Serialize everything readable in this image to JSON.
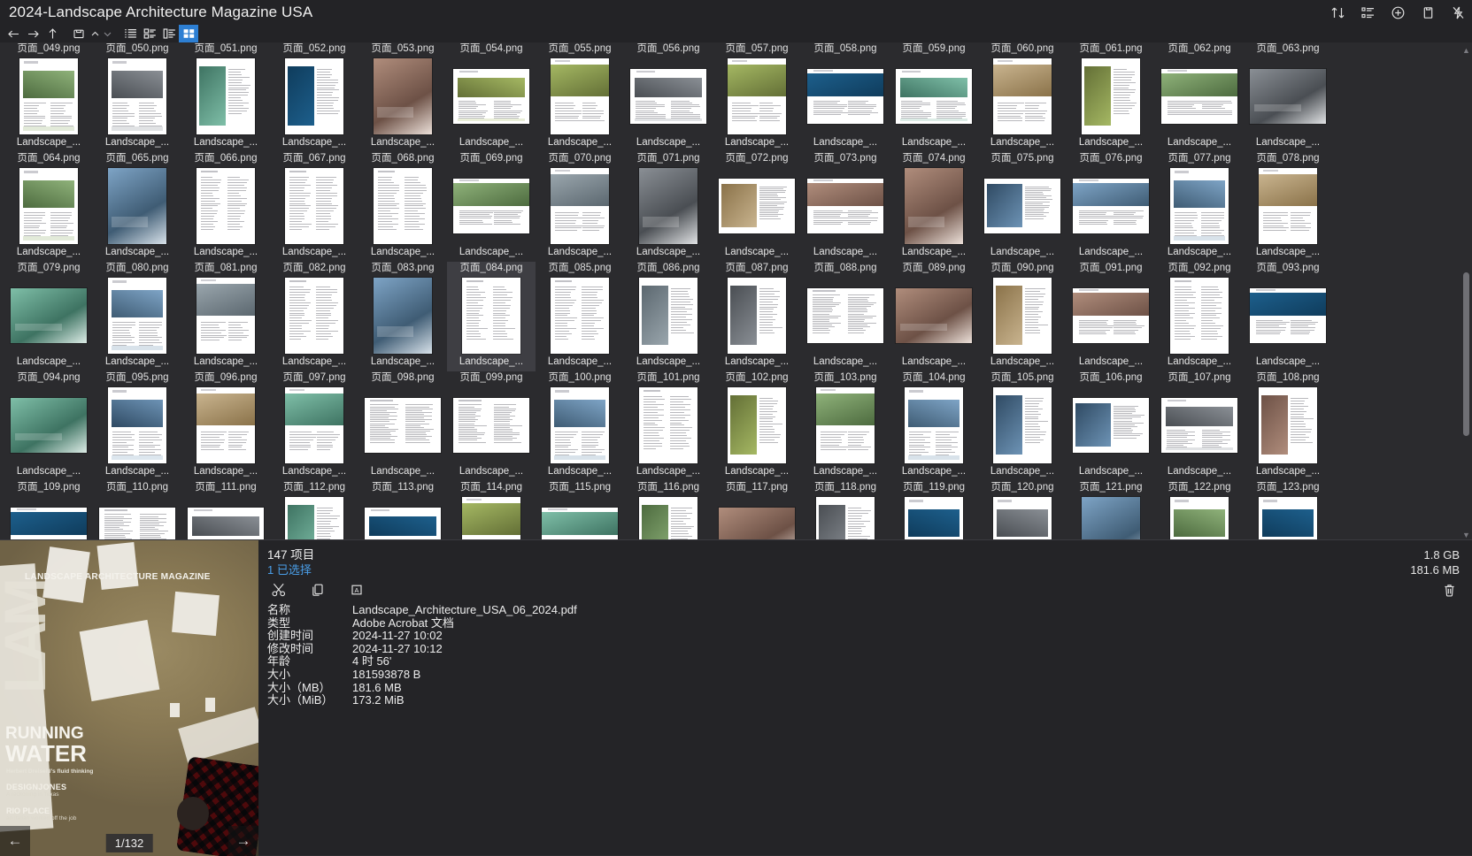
{
  "window": {
    "title": "2024-Landscape Architecture Magazine USA"
  },
  "titlebar_icons": [
    {
      "name": "sort-icon",
      "glyph": "sort"
    },
    {
      "name": "list-details-icon",
      "glyph": "details"
    },
    {
      "name": "add-circle-icon",
      "glyph": "plus-circle"
    },
    {
      "name": "clipboard-icon",
      "glyph": "clipboard"
    },
    {
      "name": "lightning-icon",
      "glyph": "bolt"
    }
  ],
  "toolbar": {
    "back": "←",
    "forward": "→",
    "up": "↑",
    "new_folder": "new-folder",
    "caret_up": "⌃",
    "caret_down": "⌄",
    "view_list": "list-view",
    "view_tiles": "tiles-view",
    "view_details": "details-view",
    "view_grid": "grid-view",
    "active_view": "grid-view"
  },
  "grid": {
    "columns": 15,
    "item_label": "Landscape_...",
    "selected_index": 35,
    "rows": [
      {
        "names": [
          "页面_049.png",
          "页面_050.png",
          "页面_051.png",
          "页面_052.png",
          "页面_053.png",
          "页面_054.png",
          "页面_055.png",
          "页面_056.png",
          "页面_057.png",
          "页面_058.png",
          "页面_059.png",
          "页面_060.png",
          "页面_061.png",
          "页面_062.png",
          "页面_063.png"
        ]
      },
      {
        "names": [
          "页面_064.png",
          "页面_065.png",
          "页面_066.png",
          "页面_067.png",
          "页面_068.png",
          "页面_069.png",
          "页面_070.png",
          "页面_071.png",
          "页面_072.png",
          "页面_073.png",
          "页面_074.png",
          "页面_075.png",
          "页面_076.png",
          "页面_077.png",
          "页面_078.png"
        ]
      },
      {
        "names": [
          "页面_079.png",
          "页面_080.png",
          "页面_081.png",
          "页面_082.png",
          "页面_083.png",
          "页面_084.png",
          "页面_085.png",
          "页面_086.png",
          "页面_087.png",
          "页面_088.png",
          "页面_089.png",
          "页面_090.png",
          "页面_091.png",
          "页面_092.png",
          "页面_093.png"
        ]
      },
      {
        "names": [
          "页面_094.png",
          "页面_095.png",
          "页面_096.png",
          "页面_097.png",
          "页面_098.png",
          "页面_099.png",
          "页面_100.png",
          "页面_101.png",
          "页面_102.png",
          "页面_103.png",
          "页面_104.png",
          "页面_105.png",
          "页面_106.png",
          "页面_107.png",
          "页面_108.png"
        ]
      },
      {
        "names": [
          "页面_109.png",
          "页面_110.png",
          "页面_111.png",
          "页面_112.png",
          "页面_113.png",
          "页面_114.png",
          "页面_115.png",
          "页面_116.png",
          "页面_117.png",
          "页面_118.png",
          "页面_119.png",
          "页面_120.png",
          "页面_121.png",
          "页面_122.png",
          "页面_123.png"
        ]
      },
      {
        "names": [
          "",
          "",
          "",
          "",
          "",
          "",
          "",
          "",
          "",
          "",
          "",
          "",
          "",
          "",
          ""
        ]
      }
    ]
  },
  "preview": {
    "magazine_title": "LANDSCAPE ARCHITECTURE MAGAZINE",
    "lam_letters": "LAM",
    "headline_1": "RUNNING",
    "headline_2": "WATER",
    "sub_1": "Herbert Dreiseitl's fluid thinking",
    "brand": "DESIGNJONES",
    "brand_sub": "A reckoning in Texas",
    "place": "RIO PLACE",
    "place_sub": "an Italian worked off the job",
    "counter": "1/132",
    "prev_arrow": "←",
    "next_arrow": "→"
  },
  "status": {
    "item_count": "147 项目",
    "selected_count": "1 已选择",
    "total_size": "1.8 GB",
    "selected_size": "181.6 MB"
  },
  "actions": [
    {
      "name": "cut-button",
      "icon": "scissors"
    },
    {
      "name": "copy-button",
      "icon": "copy"
    },
    {
      "name": "rename-button",
      "icon": "rename"
    }
  ],
  "trash": {
    "name": "delete-button",
    "icon": "trash"
  },
  "metadata": {
    "rows": [
      {
        "key": "名称",
        "value": "Landscape_Architecture_USA_06_2024.pdf"
      },
      {
        "key": "类型",
        "value": "Adobe Acrobat 文档"
      },
      {
        "key": "创建时间",
        "value": "2024-11-27  10:02"
      },
      {
        "key": "修改时间",
        "value": "2024-11-27  10:12"
      },
      {
        "key": "年龄",
        "value": "4 时 56'"
      },
      {
        "key": "大小",
        "value": "181593878 B"
      },
      {
        "key": "大小（MB）",
        "value": "181.6 MB"
      },
      {
        "key": "大小（MiB）",
        "value": "173.2 MiB"
      }
    ]
  },
  "colors": {
    "accent": "#2d7fd3",
    "link": "#4a9ee8",
    "bg": "#2b2b2e",
    "chrome": "#232326",
    "panel": "#242427",
    "selection": "#3e3e43"
  }
}
